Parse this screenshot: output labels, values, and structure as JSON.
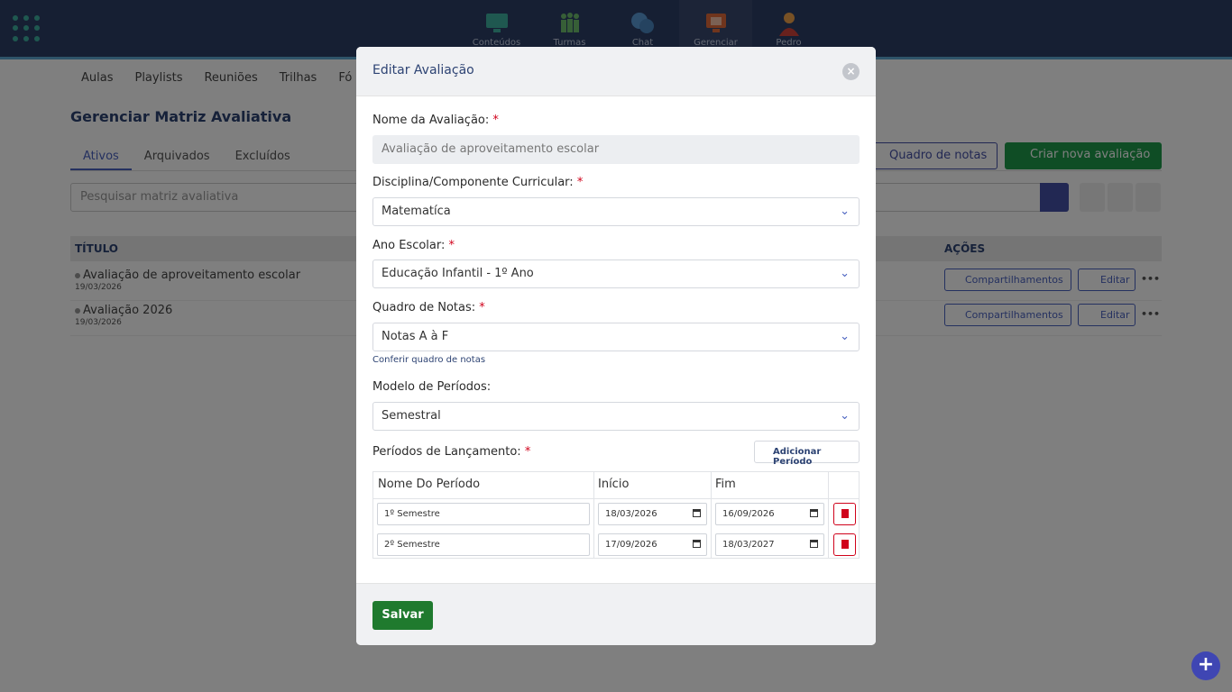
{
  "topnav": {
    "items": [
      {
        "label": "Conteúdos",
        "icon": "monitor-icon"
      },
      {
        "label": "Turmas",
        "icon": "people-icon"
      },
      {
        "label": "Chat",
        "icon": "chat-icon"
      },
      {
        "label": "Gerenciar",
        "icon": "manage-icon",
        "active": true
      },
      {
        "label": "Pedro",
        "icon": "user-avatar-icon"
      }
    ]
  },
  "subnav": [
    "Aulas",
    "Playlists",
    "Reuniões",
    "Trilhas",
    "Fó"
  ],
  "page": {
    "title": "Gerenciar Matriz Avaliativa",
    "tabs": [
      "Ativos",
      "Arquivados",
      "Excluídos"
    ],
    "active_tab": "Ativos",
    "quadro_button": "Quadro de notas",
    "criar_button": "Criar nova avaliação",
    "search_placeholder": "Pesquisar matriz avaliativa",
    "table_headers": {
      "titulo": "TÍTULO",
      "acoes": "AÇÕES"
    },
    "rows": [
      {
        "title": "Avaliação de aproveitamento escolar",
        "date": "19/03/2026",
        "share": "Compartilhamentos",
        "edit": "Editar"
      },
      {
        "title": "Avaliação 2026",
        "date": "19/03/2026",
        "share": "Compartilhamentos",
        "edit": "Editar"
      }
    ]
  },
  "modal": {
    "title": "Editar Avaliação",
    "nome_label": "Nome da Avaliação:",
    "nome_value": "Avaliação de aproveitamento escolar",
    "disciplina_label": "Disciplina/Componente Curricular:",
    "disciplina_value": "Matematíca",
    "ano_label": "Ano Escolar:",
    "ano_value": "Educação Infantil - 1º Ano",
    "quadro_label": "Quadro de Notas:",
    "quadro_value": "Notas A à F",
    "quadro_link": "Conferir quadro de notas",
    "modelo_label": "Modelo de Períodos:",
    "modelo_value": "Semestral",
    "periodos_label": "Períodos de Lançamento:",
    "add_periodo": "Adicionar Período",
    "periodos_headers": {
      "nome": "Nome Do Período",
      "inicio": "Início",
      "fim": "Fim"
    },
    "periodos": [
      {
        "nome": "1º Semestre",
        "inicio": "18/03/2026",
        "fim": "16/09/2026"
      },
      {
        "nome": "2º Semestre",
        "inicio": "17/09/2026",
        "fim": "18/03/2027"
      }
    ],
    "save_label": "Salvar"
  },
  "colors": {
    "topbar": "#2c3e66",
    "accent": "#4450a6",
    "green": "#1f9a4a",
    "danger": "#d0021b"
  }
}
